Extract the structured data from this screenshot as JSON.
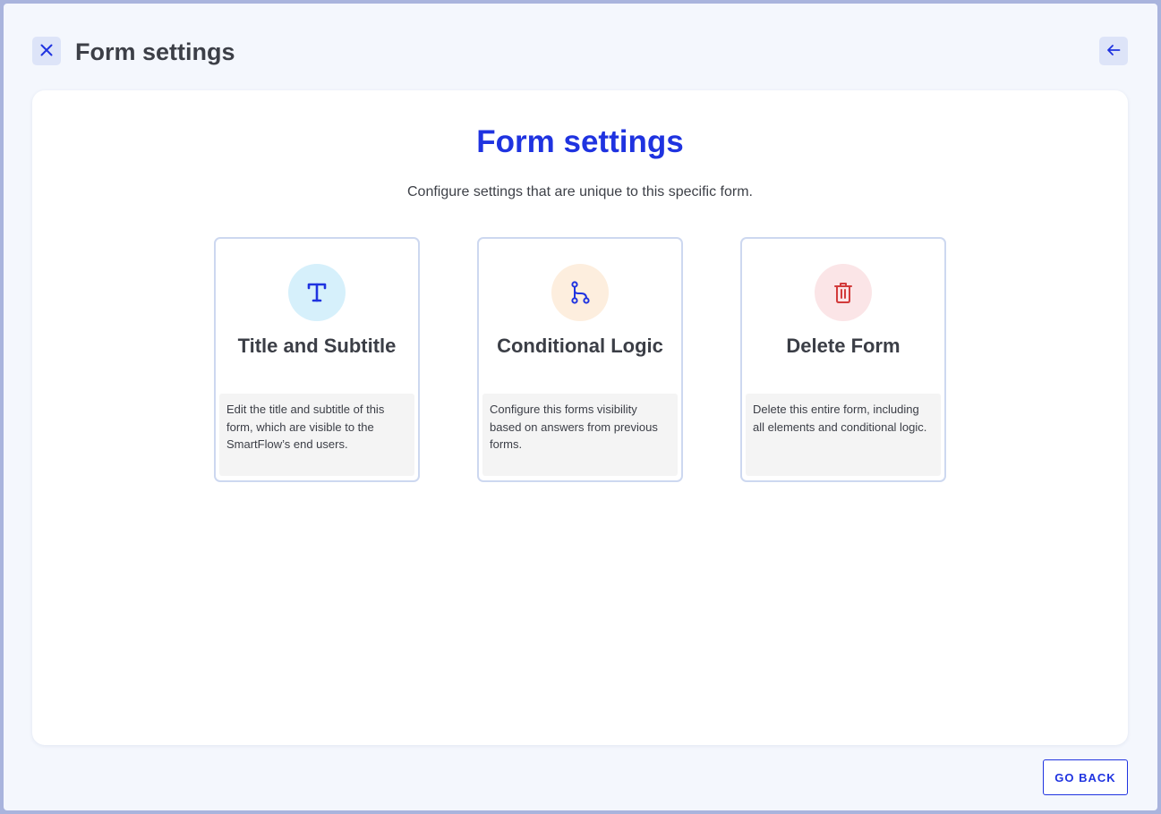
{
  "header": {
    "title": "Form settings",
    "close_icon": "close-icon",
    "back_icon": "arrow-left-icon"
  },
  "main": {
    "title": "Form settings",
    "subtitle": "Configure settings that are unique to this specific form."
  },
  "cards": [
    {
      "title": "Title and Subtitle",
      "description": "Edit the title and subtitle of this form, which are visible to the SmartFlow’s end users.",
      "icon": "text-t-icon",
      "icon_bg": "#d6f0fb",
      "icon_color": "#1f33e0"
    },
    {
      "title": "Conditional Logic",
      "description": "Configure this forms visibility based on answers from previous forms.",
      "icon": "branch-icon",
      "icon_bg": "#fdeede",
      "icon_color": "#1f33e0"
    },
    {
      "title": "Delete Form",
      "description": "Delete this entire form, including all elements and conditional logic.",
      "icon": "trash-icon",
      "icon_bg": "#fbe5e7",
      "icon_color": "#d23b3b"
    }
  ],
  "footer": {
    "go_back_label": "GO BACK"
  },
  "colors": {
    "accent": "#1f33e0",
    "background": "#f4f7fd",
    "panel": "#ffffff",
    "danger": "#d23b3b"
  }
}
